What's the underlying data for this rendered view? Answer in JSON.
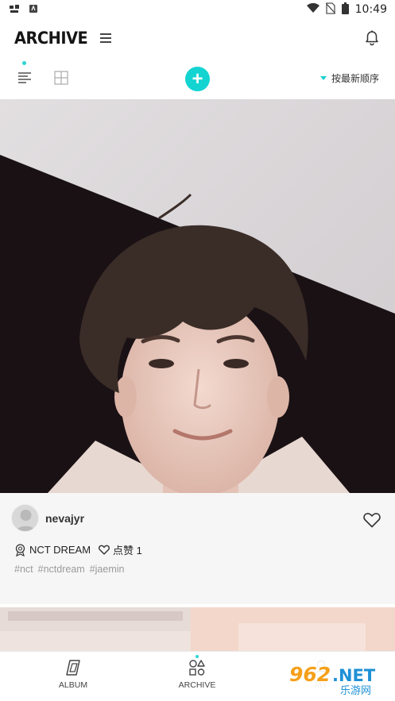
{
  "status_bar": {
    "time": "10:49",
    "left_icons": [
      "bug-icon",
      "android-icon"
    ],
    "right_icons": [
      "wifi-icon",
      "no-sim-icon",
      "battery-icon"
    ]
  },
  "header": {
    "logo": "ARCHIVE",
    "menu_icon": "hamburger-icon",
    "notification_icon": "bell-icon"
  },
  "toolbar": {
    "views": [
      "list-view-icon",
      "grid-view-icon"
    ],
    "active_view": "list",
    "add_label": "+",
    "sort_label": "按最新顺序"
  },
  "post": {
    "username": "nevajyr",
    "group": "NCT DREAM",
    "likes_label": "点赞 1",
    "tags": [
      "#nct",
      "#nctdream",
      "#jaemin"
    ]
  },
  "bottom_nav": {
    "items": [
      {
        "label": "ALBUM",
        "icon": "album-icon"
      },
      {
        "label": "ARCHIVE",
        "icon": "archive-shapes-icon",
        "active": true
      },
      {
        "label": "MY",
        "icon": "profile-icon"
      }
    ]
  },
  "watermark": {
    "brand": "962.NET",
    "sub": "乐游网"
  },
  "colors": {
    "accent": "#14d4d2",
    "tag_gray": "#9a9a9a",
    "card_bg": "#f6f6f6"
  }
}
